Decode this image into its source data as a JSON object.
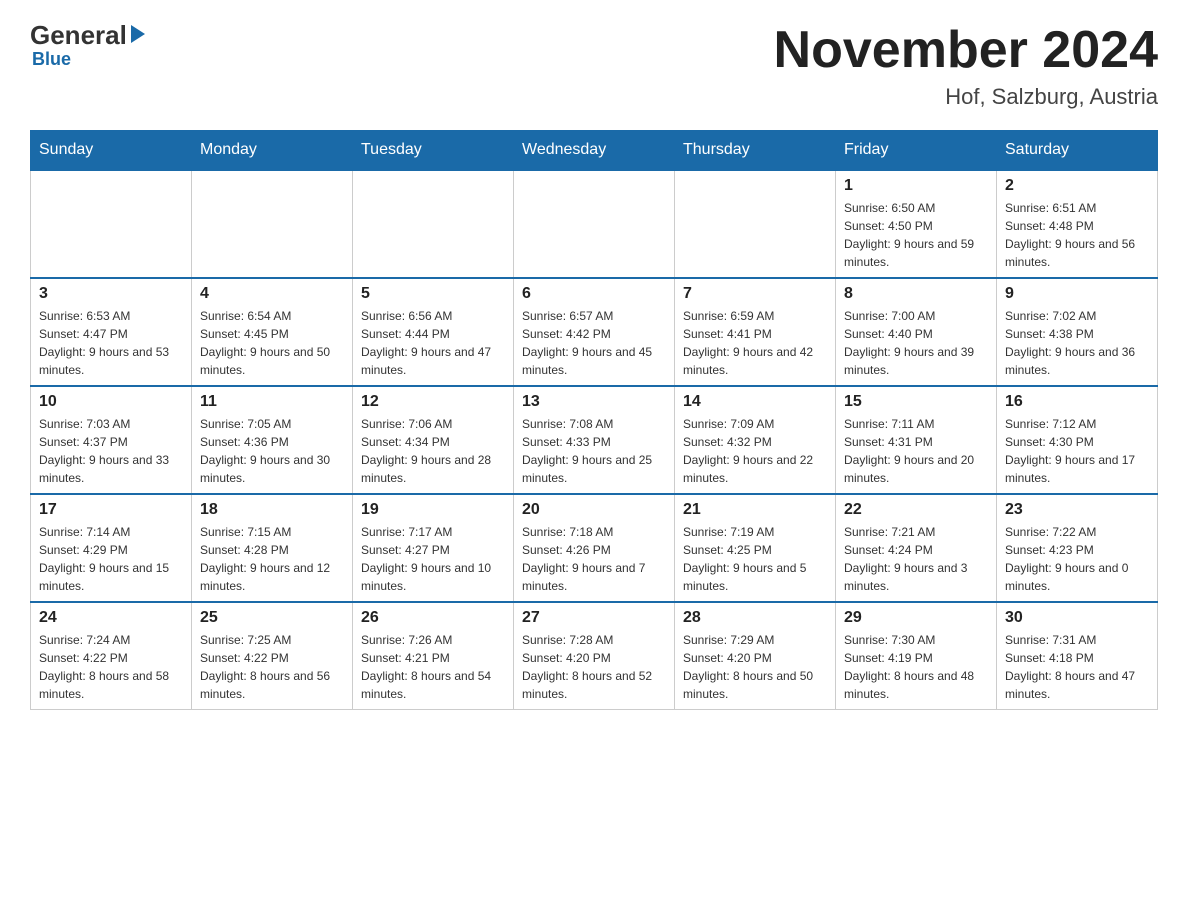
{
  "logo": {
    "general": "General",
    "blue": "Blue"
  },
  "header": {
    "title": "November 2024",
    "subtitle": "Hof, Salzburg, Austria"
  },
  "weekdays": [
    "Sunday",
    "Monday",
    "Tuesday",
    "Wednesday",
    "Thursday",
    "Friday",
    "Saturday"
  ],
  "weeks": [
    [
      {
        "day": "",
        "info": ""
      },
      {
        "day": "",
        "info": ""
      },
      {
        "day": "",
        "info": ""
      },
      {
        "day": "",
        "info": ""
      },
      {
        "day": "",
        "info": ""
      },
      {
        "day": "1",
        "info": "Sunrise: 6:50 AM\nSunset: 4:50 PM\nDaylight: 9 hours and 59 minutes."
      },
      {
        "day": "2",
        "info": "Sunrise: 6:51 AM\nSunset: 4:48 PM\nDaylight: 9 hours and 56 minutes."
      }
    ],
    [
      {
        "day": "3",
        "info": "Sunrise: 6:53 AM\nSunset: 4:47 PM\nDaylight: 9 hours and 53 minutes."
      },
      {
        "day": "4",
        "info": "Sunrise: 6:54 AM\nSunset: 4:45 PM\nDaylight: 9 hours and 50 minutes."
      },
      {
        "day": "5",
        "info": "Sunrise: 6:56 AM\nSunset: 4:44 PM\nDaylight: 9 hours and 47 minutes."
      },
      {
        "day": "6",
        "info": "Sunrise: 6:57 AM\nSunset: 4:42 PM\nDaylight: 9 hours and 45 minutes."
      },
      {
        "day": "7",
        "info": "Sunrise: 6:59 AM\nSunset: 4:41 PM\nDaylight: 9 hours and 42 minutes."
      },
      {
        "day": "8",
        "info": "Sunrise: 7:00 AM\nSunset: 4:40 PM\nDaylight: 9 hours and 39 minutes."
      },
      {
        "day": "9",
        "info": "Sunrise: 7:02 AM\nSunset: 4:38 PM\nDaylight: 9 hours and 36 minutes."
      }
    ],
    [
      {
        "day": "10",
        "info": "Sunrise: 7:03 AM\nSunset: 4:37 PM\nDaylight: 9 hours and 33 minutes."
      },
      {
        "day": "11",
        "info": "Sunrise: 7:05 AM\nSunset: 4:36 PM\nDaylight: 9 hours and 30 minutes."
      },
      {
        "day": "12",
        "info": "Sunrise: 7:06 AM\nSunset: 4:34 PM\nDaylight: 9 hours and 28 minutes."
      },
      {
        "day": "13",
        "info": "Sunrise: 7:08 AM\nSunset: 4:33 PM\nDaylight: 9 hours and 25 minutes."
      },
      {
        "day": "14",
        "info": "Sunrise: 7:09 AM\nSunset: 4:32 PM\nDaylight: 9 hours and 22 minutes."
      },
      {
        "day": "15",
        "info": "Sunrise: 7:11 AM\nSunset: 4:31 PM\nDaylight: 9 hours and 20 minutes."
      },
      {
        "day": "16",
        "info": "Sunrise: 7:12 AM\nSunset: 4:30 PM\nDaylight: 9 hours and 17 minutes."
      }
    ],
    [
      {
        "day": "17",
        "info": "Sunrise: 7:14 AM\nSunset: 4:29 PM\nDaylight: 9 hours and 15 minutes."
      },
      {
        "day": "18",
        "info": "Sunrise: 7:15 AM\nSunset: 4:28 PM\nDaylight: 9 hours and 12 minutes."
      },
      {
        "day": "19",
        "info": "Sunrise: 7:17 AM\nSunset: 4:27 PM\nDaylight: 9 hours and 10 minutes."
      },
      {
        "day": "20",
        "info": "Sunrise: 7:18 AM\nSunset: 4:26 PM\nDaylight: 9 hours and 7 minutes."
      },
      {
        "day": "21",
        "info": "Sunrise: 7:19 AM\nSunset: 4:25 PM\nDaylight: 9 hours and 5 minutes."
      },
      {
        "day": "22",
        "info": "Sunrise: 7:21 AM\nSunset: 4:24 PM\nDaylight: 9 hours and 3 minutes."
      },
      {
        "day": "23",
        "info": "Sunrise: 7:22 AM\nSunset: 4:23 PM\nDaylight: 9 hours and 0 minutes."
      }
    ],
    [
      {
        "day": "24",
        "info": "Sunrise: 7:24 AM\nSunset: 4:22 PM\nDaylight: 8 hours and 58 minutes."
      },
      {
        "day": "25",
        "info": "Sunrise: 7:25 AM\nSunset: 4:22 PM\nDaylight: 8 hours and 56 minutes."
      },
      {
        "day": "26",
        "info": "Sunrise: 7:26 AM\nSunset: 4:21 PM\nDaylight: 8 hours and 54 minutes."
      },
      {
        "day": "27",
        "info": "Sunrise: 7:28 AM\nSunset: 4:20 PM\nDaylight: 8 hours and 52 minutes."
      },
      {
        "day": "28",
        "info": "Sunrise: 7:29 AM\nSunset: 4:20 PM\nDaylight: 8 hours and 50 minutes."
      },
      {
        "day": "29",
        "info": "Sunrise: 7:30 AM\nSunset: 4:19 PM\nDaylight: 8 hours and 48 minutes."
      },
      {
        "day": "30",
        "info": "Sunrise: 7:31 AM\nSunset: 4:18 PM\nDaylight: 8 hours and 47 minutes."
      }
    ]
  ]
}
